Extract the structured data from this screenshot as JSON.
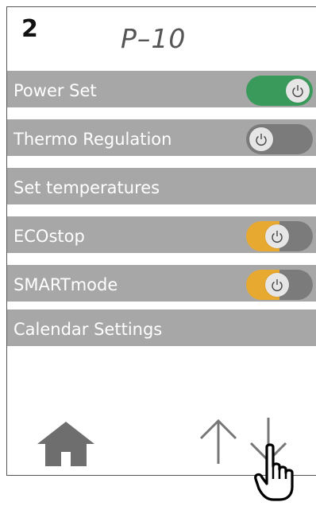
{
  "header": {
    "step_number": "2",
    "title": "P–10"
  },
  "rows": [
    {
      "label": "Power Set",
      "toggle": {
        "state": "on",
        "color": "#3a9a5b",
        "icon": "power-icon"
      }
    },
    {
      "label": "Thermo Regulation",
      "toggle": {
        "state": "off",
        "color": "#7b7b7b",
        "icon": "power-icon"
      }
    },
    {
      "label": "Set temperatures"
    },
    {
      "label": "ECOstop",
      "toggle": {
        "state": "on",
        "color": "#e8a931",
        "icon": "power-icon"
      }
    },
    {
      "label": "SMARTmode",
      "toggle": {
        "state": "on",
        "color": "#e8a931",
        "icon": "power-icon"
      }
    },
    {
      "label": "Calendar Settings"
    }
  ],
  "footer": {
    "icons": [
      "home-icon",
      "arrow-up-icon",
      "arrow-down-icon",
      "hand-pointer-icon"
    ]
  }
}
